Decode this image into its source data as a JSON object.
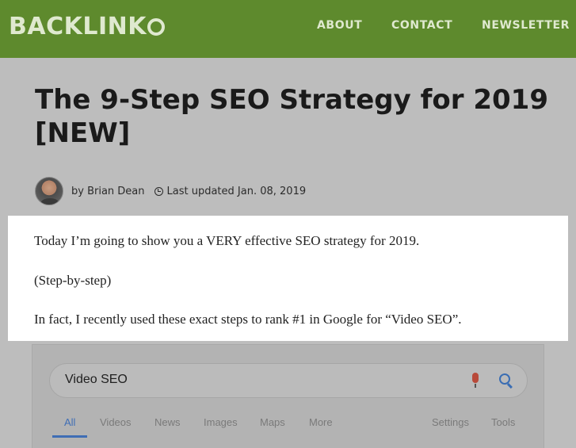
{
  "header": {
    "logo_text": "BACKLINK",
    "nav": [
      "ABOUT",
      "CONTACT",
      "NEWSLETTER"
    ],
    "bg_color": "#5e8a2d"
  },
  "article": {
    "title": "The 9-Step SEO Strategy for 2019 [NEW]",
    "author": "by Brian Dean",
    "updated": "Last updated Jan. 08, 2019",
    "paragraphs": [
      "Today I’m going to show you a VERY effective SEO strategy for 2019.",
      "(Step-by-step)",
      "In fact, I recently used these exact steps to rank #1 in Google for “Video SEO”."
    ]
  },
  "google": {
    "query": "Video SEO",
    "tabs": [
      "All",
      "Videos",
      "News",
      "Images",
      "Maps",
      "More"
    ],
    "right_tabs": [
      "Settings",
      "Tools"
    ],
    "active_tab": "All"
  }
}
